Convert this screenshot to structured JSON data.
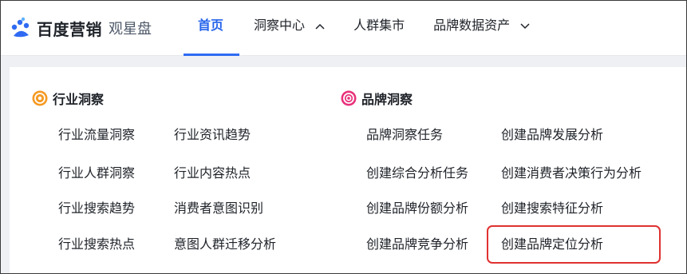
{
  "brand": {
    "name": "百度营销",
    "product": "观星盘"
  },
  "nav": {
    "home": "首页",
    "insight": "洞察中心",
    "crowd": "人群集市",
    "brand_assets": "品牌数据资产"
  },
  "colors": {
    "accent": "#2f6bf2",
    "industry_icon": "#f59a23",
    "brand_icon": "#e8327c",
    "highlight": "#e03131"
  },
  "industry": {
    "title": "行业洞察",
    "icon": "target-icon",
    "col1": [
      "行业流量洞察",
      "行业人群洞察",
      "行业搜索趋势",
      "行业搜索热点"
    ],
    "col2": [
      "行业资讯趋势",
      "行业内容热点",
      "消费者意图识别",
      "意图人群迁移分析"
    ]
  },
  "brand_insight": {
    "title": "品牌洞察",
    "icon": "spiral-icon",
    "col1": [
      "品牌洞察任务",
      "创建综合分析任务",
      "创建品牌份额分析",
      "创建品牌竞争分析"
    ],
    "col2": [
      "创建品牌发展分析",
      "创建消费者决策行为分析",
      "创建搜索特征分析",
      "创建品牌定位分析"
    ]
  }
}
